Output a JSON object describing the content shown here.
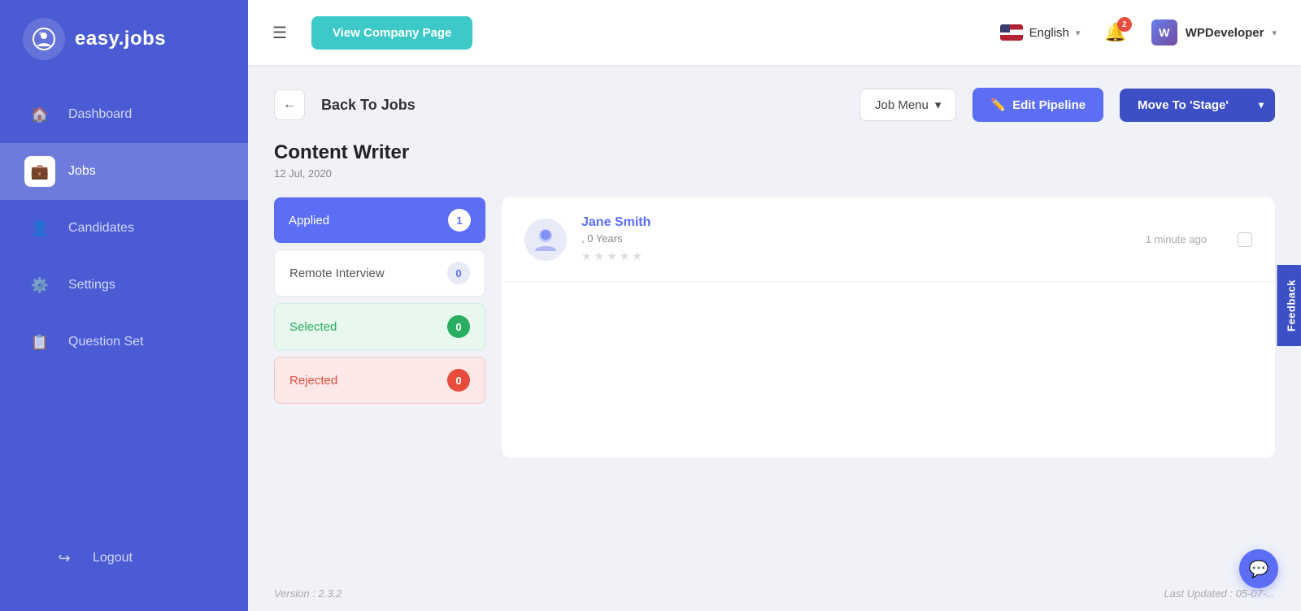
{
  "app": {
    "name": "easy.jobs",
    "logo_text": "easy.jobs"
  },
  "sidebar": {
    "nav_items": [
      {
        "id": "dashboard",
        "label": "Dashboard",
        "icon": "🏠",
        "active": false
      },
      {
        "id": "jobs",
        "label": "Jobs",
        "icon": "💼",
        "active": true
      },
      {
        "id": "candidates",
        "label": "Candidates",
        "icon": "👤",
        "active": false
      },
      {
        "id": "settings",
        "label": "Settings",
        "icon": "⚙️",
        "active": false
      },
      {
        "id": "question-set",
        "label": "Question Set",
        "icon": "📋",
        "active": false
      }
    ],
    "logout_label": "Logout"
  },
  "header": {
    "view_company_label": "View Company Page",
    "language": "English",
    "notification_count": "2",
    "user_name": "WPDeveloper"
  },
  "breadcrumb": {
    "back_label": "Back To Jobs"
  },
  "toolbar": {
    "job_menu_label": "Job Menu",
    "edit_pipeline_label": "Edit Pipeline",
    "move_to_stage_label": "Move To 'Stage'"
  },
  "job": {
    "title": "Content Writer",
    "date": "12 Jul, 2020"
  },
  "pipeline": {
    "stages": [
      {
        "id": "applied",
        "label": "Applied",
        "count": "1",
        "style": "applied"
      },
      {
        "id": "remote-interview",
        "label": "Remote Interview",
        "count": "0",
        "style": "remote-interview"
      },
      {
        "id": "selected",
        "label": "Selected",
        "count": "0",
        "style": "selected"
      },
      {
        "id": "rejected",
        "label": "Rejected",
        "count": "0",
        "style": "rejected"
      }
    ]
  },
  "candidates": [
    {
      "name": "Jane Smith",
      "experience": ", 0 Years",
      "stars": [
        false,
        false,
        false,
        false,
        false
      ],
      "time": "1 minute ago"
    }
  ],
  "footer": {
    "version": "Version : 2.3.2",
    "last_updated": "Last Updated : 05-07-..."
  },
  "feedback": {
    "label": "Feedback"
  },
  "chat": {
    "icon": "💬"
  }
}
